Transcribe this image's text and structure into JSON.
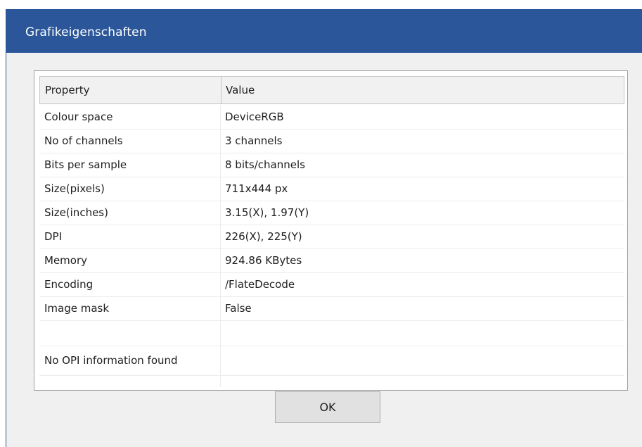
{
  "dialog": {
    "title": "Grafikeigenschaften",
    "ok_label": "OK"
  },
  "table": {
    "columns": [
      "Property",
      "Value"
    ],
    "rows": [
      {
        "property": "Colour space",
        "value": "DeviceRGB"
      },
      {
        "property": "No of channels",
        "value": "3 channels"
      },
      {
        "property": "Bits per sample",
        "value": "8 bits/channels"
      },
      {
        "property": "Size(pixels)",
        "value": "711x444 px"
      },
      {
        "property": "Size(inches)",
        "value": "3.15(X), 1.97(Y)"
      },
      {
        "property": "DPI",
        "value": "226(X), 225(Y)"
      },
      {
        "property": "Memory",
        "value": "924.86 KBytes"
      },
      {
        "property": "Encoding",
        "value": "/FlateDecode"
      },
      {
        "property": "Image mask",
        "value": "False"
      },
      {
        "property": "",
        "value": ""
      },
      {
        "property": "No OPI information found",
        "value": ""
      }
    ]
  },
  "colors": {
    "titlebar": "#2b579a",
    "window_background": "#f0f0f0",
    "button_background": "#e1e1e1",
    "button_border": "#adadad"
  }
}
